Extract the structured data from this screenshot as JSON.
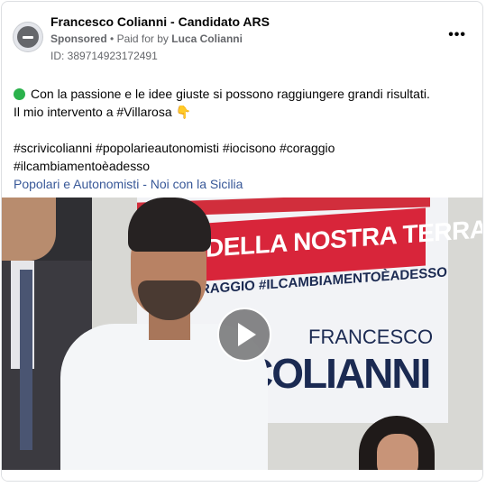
{
  "post": {
    "page_name": "Francesco Colianni - Candidato ARS",
    "sponsored_label": "Sponsored",
    "separator": "•",
    "paid_for_by_label": "Paid for by",
    "payer": "Luca Colianni",
    "ad_id": "ID: 389714923172491",
    "more_label": "•••",
    "text_line1": "Con la passione e le idee giuste si possono raggiungere grandi risultati.",
    "text_line2": "Il mio intervento a #Villarosa",
    "emoji_point": "👇",
    "hashtags_line1": "#scrivicolianni #popolarieautonomisti #iocisono #coraggio",
    "hashtags_line2": "#ilcambiamentoèadesso",
    "page_link": "Popolari e Autonomisti - Noi con la Sicilia"
  },
  "video": {
    "banner_top": "DELLA NOSTRA TERRA",
    "banner_tagline": "RAGGIO #ILCAMBIAMENTOÈADESSO",
    "banner_first_name": "FRANCESCO",
    "banner_last_name": "COLIANNI",
    "play_icon": "play-icon"
  },
  "colors": {
    "status_dot": "#2bb24c",
    "link": "#385898",
    "banner_red": "#d8253a",
    "banner_navy": "#1b2a52"
  }
}
